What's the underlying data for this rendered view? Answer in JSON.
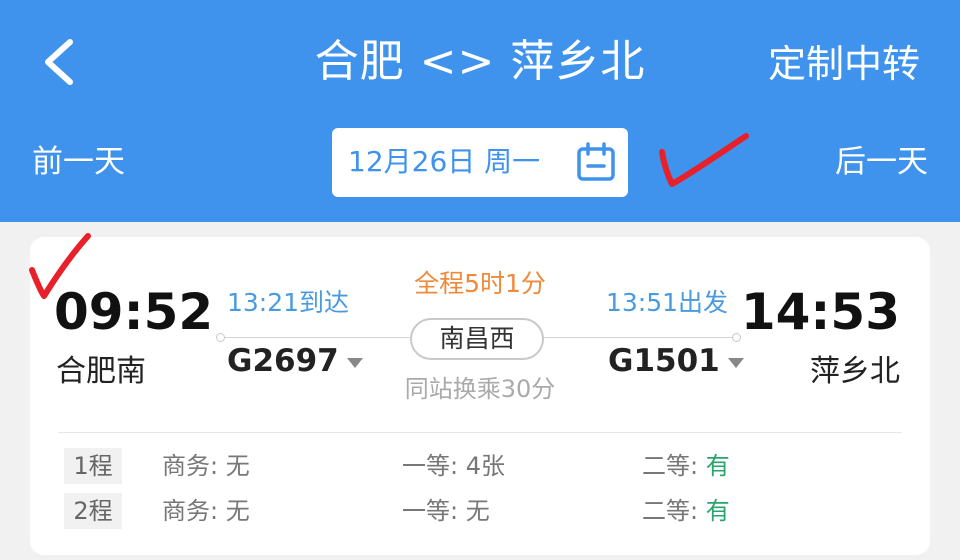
{
  "header": {
    "title": "合肥 <> 萍乡北",
    "custom_transfer": "定制中转",
    "back_icon": "chevron-left-icon"
  },
  "date_bar": {
    "prev_day": "前一天",
    "next_day": "后一天",
    "date": "12月26日 周一",
    "calendar_icon": "calendar-icon"
  },
  "trip": {
    "departure_time": "09:52",
    "departure_station": "合肥南",
    "arrival_time": "14:53",
    "arrival_station": "萍乡北",
    "total_duration": "全程5时1分",
    "leg1": {
      "arrive": "13:21到达",
      "train": "G2697"
    },
    "leg2": {
      "depart": "13:51出发",
      "train": "G1501"
    },
    "transfer_station": "南昌西",
    "transfer_note": "同站换乘30分"
  },
  "seats": [
    {
      "leg": "1程",
      "business_label": "商务: ",
      "business": "无",
      "first_label": "一等: ",
      "first": "4张",
      "second_label": "二等: ",
      "second": "有"
    },
    {
      "leg": "2程",
      "business_label": "商务: ",
      "business": "无",
      "first_label": "一等: ",
      "first": "无",
      "second_label": "二等: ",
      "second": "有"
    }
  ],
  "colors": {
    "header_bg": "#3f93ec",
    "accent_blue": "#4a9ade",
    "duration_orange": "#ef8a3b",
    "available_green": "#2aa36c",
    "annotation_red": "#e8202a"
  }
}
